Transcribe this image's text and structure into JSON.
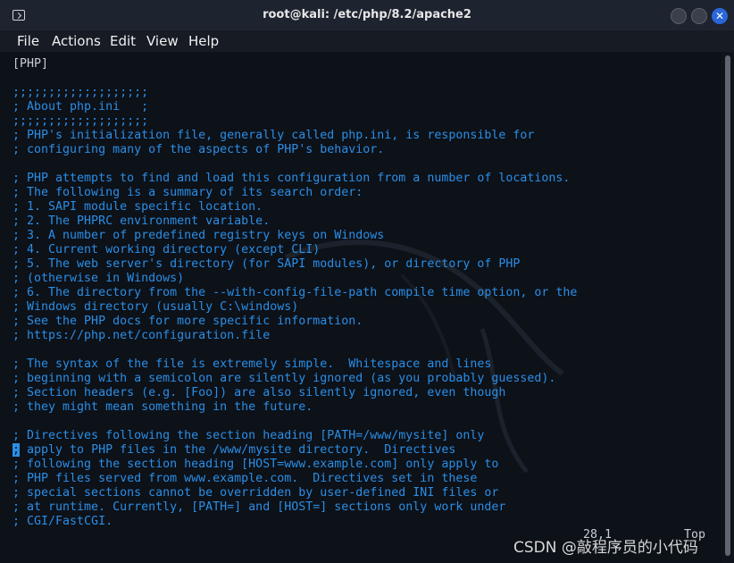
{
  "window": {
    "title": "root@kali: /etc/php/8.2/apache2",
    "close_glyph": "✕"
  },
  "menu": [
    "File",
    "Actions",
    "Edit",
    "View",
    "Help"
  ],
  "terminal": {
    "lines": [
      "[PHP]",
      "",
      ";;;;;;;;;;;;;;;;;;;",
      "; About php.ini   ;",
      ";;;;;;;;;;;;;;;;;;;",
      "; PHP's initialization file, generally called php.ini, is responsible for",
      "; configuring many of the aspects of PHP's behavior.",
      "",
      "; PHP attempts to find and load this configuration from a number of locations.",
      "; The following is a summary of its search order:",
      "; 1. SAPI module specific location.",
      "; 2. The PHPRC environment variable.",
      "; 3. A number of predefined registry keys on Windows",
      "; 4. Current working directory (except CLI)",
      "; 5. The web server's directory (for SAPI modules), or directory of PHP",
      "; (otherwise in Windows)",
      "; 6. The directory from the --with-config-file-path compile time option, or the",
      "; Windows directory (usually C:\\windows)",
      "; See the PHP docs for more specific information.",
      "; https://php.net/configuration.file",
      "",
      "; The syntax of the file is extremely simple.  Whitespace and lines",
      "; beginning with a semicolon are silently ignored (as you probably guessed).",
      "; Section headers (e.g. [Foo]) are also silently ignored, even though",
      "; they might mean something in the future.",
      "",
      "; Directives following the section heading [PATH=/www/mysite] only",
      "; apply to PHP files in the /www/mysite directory.  Directives",
      "; following the section heading [HOST=www.example.com] only apply to",
      "; PHP files served from www.example.com.  Directives set in these",
      "; special sections cannot be overridden by user-defined INI files or",
      "; at runtime. Currently, [PATH=] and [HOST=] sections only work under",
      "; CGI/FastCGI."
    ],
    "cursor_line": 27
  },
  "status": {
    "position": "28,1",
    "scroll": "Top"
  },
  "watermark": "CSDN @敲程序员的小代码"
}
